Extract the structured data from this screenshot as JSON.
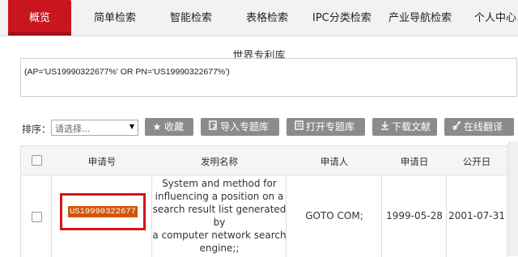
{
  "nav": {
    "tabs": [
      {
        "label": "概览",
        "active": true
      },
      {
        "label": "简单检索"
      },
      {
        "label": "智能检索"
      },
      {
        "label": "表格检索"
      },
      {
        "label": "IPC分类检索"
      },
      {
        "label": "产业导航检索"
      },
      {
        "label": "个人中心"
      }
    ]
  },
  "database_title": "世界专利库",
  "query": "(AP='US19990322677%' OR PN='US19990322677%')",
  "toolbar": {
    "sort_label": "排序：",
    "sort_placeholder": "请选择...",
    "buttons": [
      {
        "label": "收藏",
        "icon": "star-icon"
      },
      {
        "label": "导入专题库",
        "icon": "import-icon"
      },
      {
        "label": "打开专题库",
        "icon": "open-folder-icon"
      },
      {
        "label": "下载文献",
        "icon": "download-icon"
      },
      {
        "label": "在线翻译",
        "icon": "translate-icon"
      }
    ]
  },
  "table": {
    "columns": [
      "申请号",
      "发明名称",
      "申请人",
      "申请日",
      "公开日"
    ],
    "rows": [
      {
        "application_no": "US19990322677",
        "title": [
          "System and method for",
          "influencing a position on a",
          "search result list generated by",
          "a computer network search",
          "engine;;"
        ],
        "applicant": "GOTO COM;",
        "application_date": "1999-05-28",
        "publication_date": "2001-07-31"
      }
    ]
  },
  "colors": {
    "accent": "#c9161e",
    "button_bg": "#8b8b8b",
    "highlight": "#d35400"
  }
}
